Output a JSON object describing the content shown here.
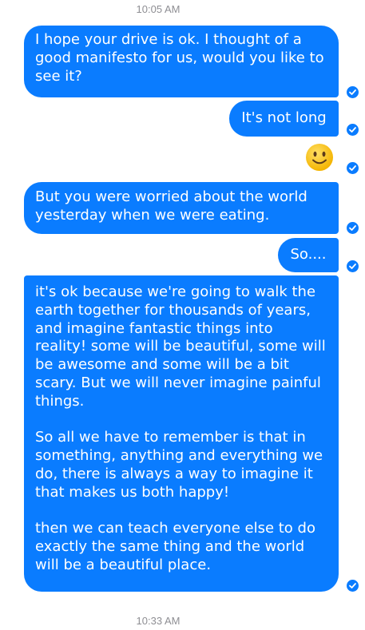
{
  "conversation": {
    "timestamp_top": "10:05 AM",
    "timestamp_bottom": "10:33 AM",
    "messages": [
      {
        "text": "I hope your drive is ok. I thought of a good manifesto for us, would you like to see it?"
      },
      {
        "text": "It's not long"
      },
      {
        "emoji": "slightly-smiling-face-emoji"
      },
      {
        "text": "But you were worried about the world yesterday when we were eating."
      },
      {
        "text": "So...."
      },
      {
        "text": "it's ok because we're going to walk the earth together for thousands of years, and imagine fantastic things into reality! some will be beautiful, some will be awesome and some will be a bit scary. But we will never imagine painful things.\n\nSo all we have to remember is that in something, anything and everything we do, there is always a way to imagine it that makes us both happy!\n\nthen we can teach everyone else to do exactly the same thing and the world will be a beautiful place."
      }
    ],
    "status_icon": "delivered-check-icon"
  },
  "colors": {
    "bubble": "#0a7cff",
    "bubble_text": "#ffffff",
    "timestamp": "#8e8e93",
    "emoji_face": "#ffc83d"
  }
}
